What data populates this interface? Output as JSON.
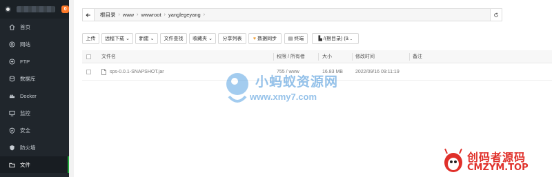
{
  "sidebar": {
    "badge": "0",
    "items": [
      {
        "label": "首页",
        "icon": "home-icon"
      },
      {
        "label": "网站",
        "icon": "globe-icon"
      },
      {
        "label": "FTP",
        "icon": "ftp-icon"
      },
      {
        "label": "数据库",
        "icon": "database-icon"
      },
      {
        "label": "Docker",
        "icon": "docker-icon"
      },
      {
        "label": "监控",
        "icon": "monitor-icon"
      },
      {
        "label": "安全",
        "icon": "shield-icon"
      },
      {
        "label": "防火墙",
        "icon": "firewall-icon"
      },
      {
        "label": "文件",
        "icon": "folder-icon"
      }
    ],
    "active_index": 8,
    "accent": "#20a53a"
  },
  "path": {
    "crumbs": [
      "根目录",
      "www",
      "wwwroot",
      "yanglegeyang"
    ]
  },
  "toolbar": {
    "upload": "上传",
    "remote_download": "远程下载",
    "new": "新建",
    "file_search": "文件查找",
    "favorites": "收藏夹",
    "share_list": "分享列表",
    "data_sync": "数据同步",
    "terminal": "终端",
    "disk": "/(根目录) (9..."
  },
  "table": {
    "headers": {
      "name": "文件名",
      "perm": "权限 / 所有者",
      "size": "大小",
      "mtime": "修改时间",
      "note": "备注"
    },
    "rows": [
      {
        "name": "sps-0.0.1-SNAPSHOT.jar",
        "perm": "755 / www",
        "size": "16.83 MB",
        "mtime": "2022/09/16 09:11:19",
        "note": ""
      }
    ]
  },
  "watermarks": {
    "site1_title": "小蚂蚁资源网",
    "site1_url": "www.xmy7.com",
    "site2_title": "创码者源码",
    "site2_url": "CMZYM.TOP"
  }
}
